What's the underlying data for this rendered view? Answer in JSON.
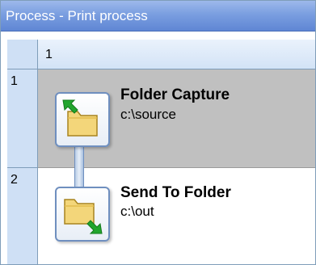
{
  "window": {
    "title": "Process - Print process"
  },
  "grid": {
    "column_header": "1",
    "rows": [
      {
        "number": "1",
        "step_name": "Folder Capture",
        "step_path": "c:\\source",
        "icon": "folder-capture-icon",
        "selected": true
      },
      {
        "number": "2",
        "step_name": "Send To Folder",
        "step_path": "c:\\out",
        "icon": "send-to-folder-icon",
        "selected": false
      }
    ]
  },
  "colors": {
    "title_bar": "#7a9ee0",
    "selected_row": "#c0c0c0",
    "header": "#cfe0f5",
    "arrow_green": "#22a52e",
    "folder": "#f3d67a"
  }
}
